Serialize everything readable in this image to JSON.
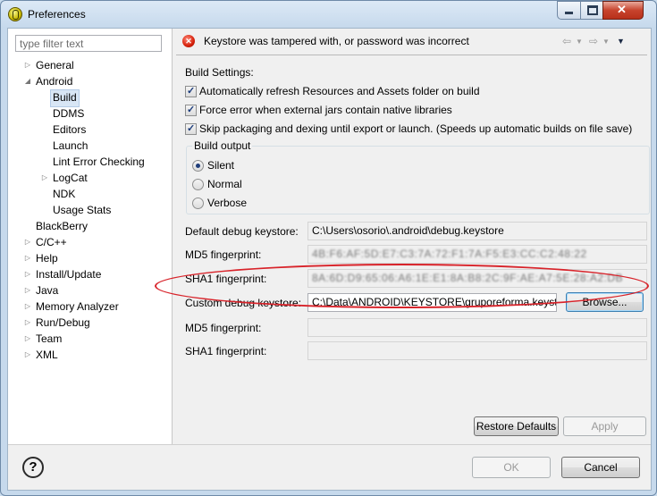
{
  "window": {
    "title": "Preferences"
  },
  "filter": {
    "placeholder": "type filter text"
  },
  "tree": [
    {
      "label": "General",
      "arrow": "▷",
      "level": 0
    },
    {
      "label": "Android",
      "arrow": "◢",
      "level": 0
    },
    {
      "label": "Build",
      "arrow": "",
      "level": 1,
      "selected": true
    },
    {
      "label": "DDMS",
      "arrow": "",
      "level": 1
    },
    {
      "label": "Editors",
      "arrow": "",
      "level": 1
    },
    {
      "label": "Launch",
      "arrow": "",
      "level": 1
    },
    {
      "label": "Lint Error Checking",
      "arrow": "",
      "level": 1
    },
    {
      "label": "LogCat",
      "arrow": "▷",
      "level": 1
    },
    {
      "label": "NDK",
      "arrow": "",
      "level": 1
    },
    {
      "label": "Usage Stats",
      "arrow": "",
      "level": 1
    },
    {
      "label": "BlackBerry",
      "arrow": "",
      "level": 0
    },
    {
      "label": "C/C++",
      "arrow": "▷",
      "level": 0
    },
    {
      "label": "Help",
      "arrow": "▷",
      "level": 0
    },
    {
      "label": "Install/Update",
      "arrow": "▷",
      "level": 0
    },
    {
      "label": "Java",
      "arrow": "▷",
      "level": 0
    },
    {
      "label": "Memory Analyzer",
      "arrow": "▷",
      "level": 0
    },
    {
      "label": "Run/Debug",
      "arrow": "▷",
      "level": 0
    },
    {
      "label": "Team",
      "arrow": "▷",
      "level": 0
    },
    {
      "label": "XML",
      "arrow": "▷",
      "level": 0
    }
  ],
  "header": {
    "error_message": "Keystore was tampered with, or password was incorrect"
  },
  "build": {
    "section_title": "Build Settings:",
    "checkboxes": [
      "Automatically refresh Resources and Assets folder on build",
      "Force error when external jars contain native libraries",
      "Skip packaging and dexing until export or launch. (Speeds up automatic builds on file save)"
    ],
    "output_title": "Build output",
    "radios": [
      "Silent",
      "Normal",
      "Verbose"
    ],
    "selected_radio": "Silent"
  },
  "keystore": {
    "default_label": "Default debug keystore:",
    "default_value": "C:\\Users\\osorio\\.android\\debug.keystore",
    "md5_label": "MD5 fingerprint:",
    "md5_value": "4B:F6:AF:5D:E7:C3:7A:72:F1:7A:F5:E3:CC:C2:48:22",
    "sha1_label": "SHA1 fingerprint:",
    "sha1_value": "8A:6D:D9:65:06:A6:1E:E1:8A:B8:2C:9F:AE:A7:5E:28:A2:DB",
    "custom_label": "Custom debug keystore:",
    "custom_value": "C:\\Data\\ANDROID\\KEYSTORE\\gruporeforma.keystore",
    "browse": "Browse...",
    "md5_label2": "MD5 fingerprint:",
    "sha1_label2": "SHA1 fingerprint:"
  },
  "buttons": {
    "restore": "Restore Defaults",
    "apply": "Apply",
    "ok": "OK",
    "cancel": "Cancel"
  },
  "colors": {
    "annotation": "#d8232a",
    "selection": "#d8e6f5"
  }
}
